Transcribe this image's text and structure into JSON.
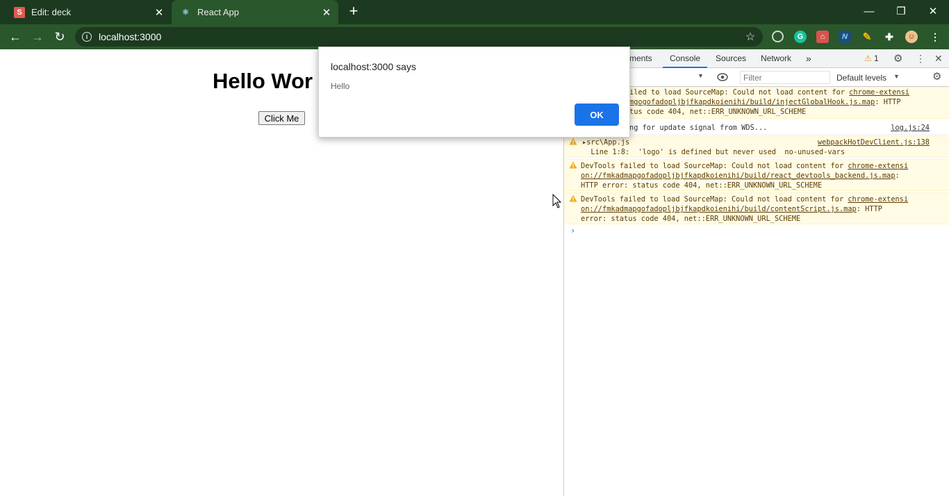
{
  "browser": {
    "tabs": [
      {
        "title": "Edit: deck",
        "favicon": "S"
      },
      {
        "title": "React App",
        "favicon": "react-icon"
      }
    ],
    "url": "localhost:3000"
  },
  "page": {
    "heading": "Hello Wor",
    "button_label": "Click Me"
  },
  "alert": {
    "title": "localhost:3000 says",
    "message": "Hello",
    "ok_label": "OK"
  },
  "devtools": {
    "tabs": [
      "ments",
      "Console",
      "Sources",
      "Network"
    ],
    "active_tab": "Console",
    "more": "»",
    "warning_count": "1",
    "filter_placeholder": "Filter",
    "levels": "Default levels",
    "messages": [
      {
        "level": "warning",
        "line1_pre": "iled to load SourceMap: Could not load content for ",
        "line1_link": "chrome-extensi",
        "line2_link": "mgogofadopljbjfkapdkoienihi/build/injectGlobalHook.js.map",
        "line2_post": ": HTTP",
        "line3": "tus code 404, net::ERR_UNKNOWN_URL_SCHEME"
      },
      {
        "level": "info",
        "text": "ng for update signal from WDS...",
        "source": "log.js:24"
      },
      {
        "level": "warning",
        "line1": "▸src\\App.js",
        "line2": "  Line 1:8:  'logo' is defined but never used  no-unused-vars",
        "source": "webpackHotDevClient.js:138"
      },
      {
        "level": "warning",
        "line1_pre": "DevTools failed to load SourceMap: Could not load content for ",
        "line1_link": "chrome-extensi",
        "line2_link": "on://fmkadmapgofadopljbjfkapdkoienihi/build/react_devtools_backend.js.map",
        "line2_post": ":",
        "line3": "HTTP error: status code 404, net::ERR_UNKNOWN_URL_SCHEME"
      },
      {
        "level": "warning",
        "line1_pre": "DevTools failed to load SourceMap: Could not load content for ",
        "line1_link": "chrome-extensi",
        "line2_link": "on://fmkadmapgofadopljbjfkapdkoienihi/build/contentScript.js.map",
        "line2_post": ": HTTP",
        "line3": "error: status code 404, net::ERR_UNKNOWN_URL_SCHEME"
      }
    ],
    "prompt": "›"
  },
  "colors": {
    "tab_strip": "#1c3a1f",
    "toolbar": "#2a572c",
    "accent": "#1a73e8",
    "warning_bg": "#fffbe5",
    "warning_text": "#5c3c00"
  }
}
